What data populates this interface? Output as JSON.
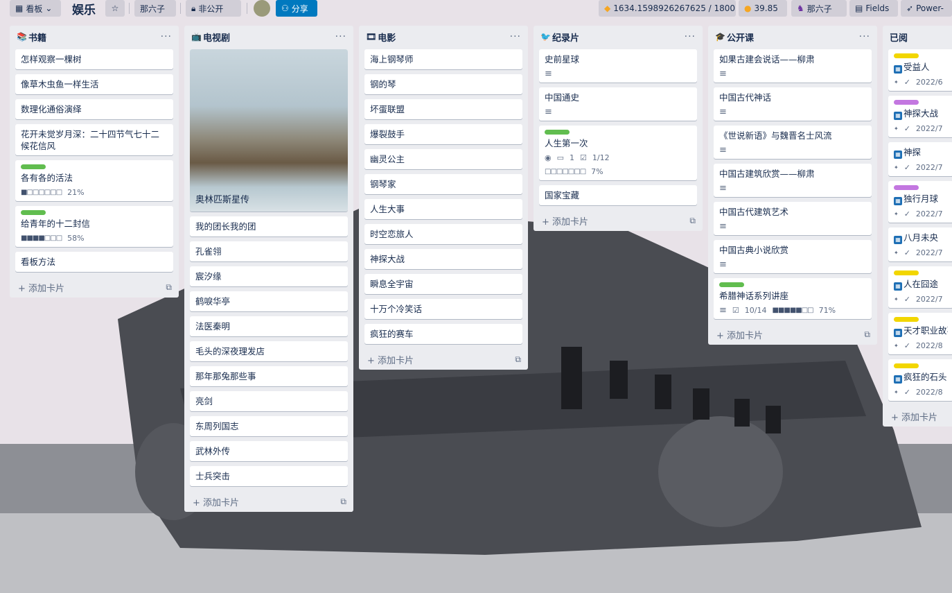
{
  "topbar": {
    "view_label": "看板",
    "board_title": "娱乐",
    "owner": "那六子",
    "visibility": "非公开",
    "share_label": "分享",
    "points": "1634.1598926267625 / 1800",
    "coins": "39.85",
    "member": "那六子",
    "fields_label": "Fields",
    "powerups_label": "Power-"
  },
  "common": {
    "add_card": "+ 添加卡片"
  },
  "lists": [
    {
      "title": "书籍",
      "icon": "📚",
      "cards": [
        {
          "title": "怎样观察一棵树"
        },
        {
          "title": "像草木虫鱼一样生活"
        },
        {
          "title": "数理化通俗演绎"
        },
        {
          "title": "花开未觉岁月深：二十四节气七十二候花信风"
        },
        {
          "title": "各有各的活法",
          "label": "#61bd4f",
          "progress": "21%",
          "progress_value": 0.21
        },
        {
          "title": "给青年的十二封信",
          "label": "#61bd4f",
          "progress": "58%",
          "progress_value": 0.58
        },
        {
          "title": "看板方法"
        }
      ]
    },
    {
      "title": "电视剧",
      "icon": "📺",
      "cards": [
        {
          "title": "奥林匹斯星传",
          "cover": true
        },
        {
          "title": "我的团长我的团"
        },
        {
          "title": "孔雀翎"
        },
        {
          "title": "宸汐缘"
        },
        {
          "title": "鹤唳华亭"
        },
        {
          "title": "法医秦明"
        },
        {
          "title": "毛头的深夜理发店"
        },
        {
          "title": "那年那兔那些事"
        },
        {
          "title": "亮剑"
        },
        {
          "title": "东周列国志"
        },
        {
          "title": "武林外传"
        },
        {
          "title": "士兵突击"
        }
      ]
    },
    {
      "title": "电影",
      "icon": "🎞",
      "cards": [
        {
          "title": "海上钢琴师"
        },
        {
          "title": "钢的琴"
        },
        {
          "title": "坏蛋联盟"
        },
        {
          "title": "爆裂鼓手"
        },
        {
          "title": "幽灵公主"
        },
        {
          "title": "钢琴家"
        },
        {
          "title": "人生大事"
        },
        {
          "title": "时空恋旅人"
        },
        {
          "title": "神探大战"
        },
        {
          "title": "瞬息全宇宙"
        },
        {
          "title": "十万个冷笑话"
        },
        {
          "title": "疯狂的赛车"
        }
      ]
    },
    {
      "title": "纪录片",
      "icon": "🐦",
      "cards": [
        {
          "title": "史前星球",
          "desc": true
        },
        {
          "title": "中国通史",
          "desc": true
        },
        {
          "title": "人生第一次",
          "label": "#61bd4f",
          "watchers": "1",
          "checklist": "1/12",
          "progress": "7%",
          "progress_value": 0.07
        },
        {
          "title": "国家宝藏"
        }
      ]
    },
    {
      "title": "公开课",
      "icon": "🎓",
      "cards": [
        {
          "title": "如果古建会说话——柳肃",
          "desc": true
        },
        {
          "title": "中国古代神话",
          "desc": true
        },
        {
          "title": "《世说新语》与魏晋名士风流",
          "desc": true
        },
        {
          "title": "中国古建筑欣赏——柳肃",
          "desc": true
        },
        {
          "title": "中国古代建筑艺术",
          "desc": true
        },
        {
          "title": "中国古典小说欣赏",
          "desc": true
        },
        {
          "title": "希腊神话系列讲座",
          "label": "#61bd4f",
          "desc": true,
          "checklist": "10/14",
          "progress": "71%",
          "progress_value": 0.71
        }
      ]
    },
    {
      "title": "已阅",
      "icon": "",
      "cards": [
        {
          "title": "受益人",
          "label": "#f2d600",
          "date": "2022/6"
        },
        {
          "title": "神探大战",
          "label": "#c377e0",
          "date": "2022/7"
        },
        {
          "title": "神探",
          "date": "2022/7"
        },
        {
          "title": "独行月球",
          "label": "#c377e0",
          "date": "2022/7"
        },
        {
          "title": "八月未央",
          "date": "2022/7"
        },
        {
          "title": "人在囧途",
          "label": "#f2d600",
          "date": "2022/7"
        },
        {
          "title": "天才职业故事",
          "label": "#f2d600",
          "date": "2022/8"
        },
        {
          "title": "疯狂的石头",
          "label": "#f2d600",
          "date": "2022/8"
        }
      ]
    }
  ]
}
